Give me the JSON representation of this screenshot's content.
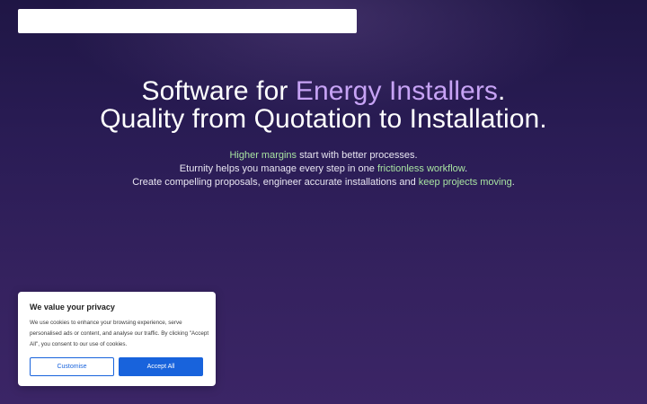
{
  "hero": {
    "title_line1_prefix": "Software for ",
    "title_line1_accent": "Energy Installers",
    "title_line1_suffix": ".",
    "title_line2": "Quality from Quotation to Installation.",
    "sub_line1_highlight": "Higher margins",
    "sub_line1_rest": " start with better processes.",
    "sub_line2_prefix": "Eturnity helps you manage every step in one ",
    "sub_line2_highlight": "frictionless workflow",
    "sub_line2_suffix": ".",
    "sub_line3_prefix": "Create compelling proposals, engineer accurate installations and ",
    "sub_line3_highlight": "keep projects moving",
    "sub_line3_suffix": "."
  },
  "cookie_banner": {
    "title": "We value your privacy",
    "text": "We use cookies to enhance your browsing experience, serve personalised ads or content, and analyse our traffic. By clicking \"Accept All\", you consent to our use of cookies.",
    "customise_label": "Customise",
    "accept_label": "Accept All"
  },
  "colors": {
    "accent_purple": "#c7a3f5",
    "highlight_green": "#a8e3a1",
    "button_blue": "#1863dc"
  }
}
